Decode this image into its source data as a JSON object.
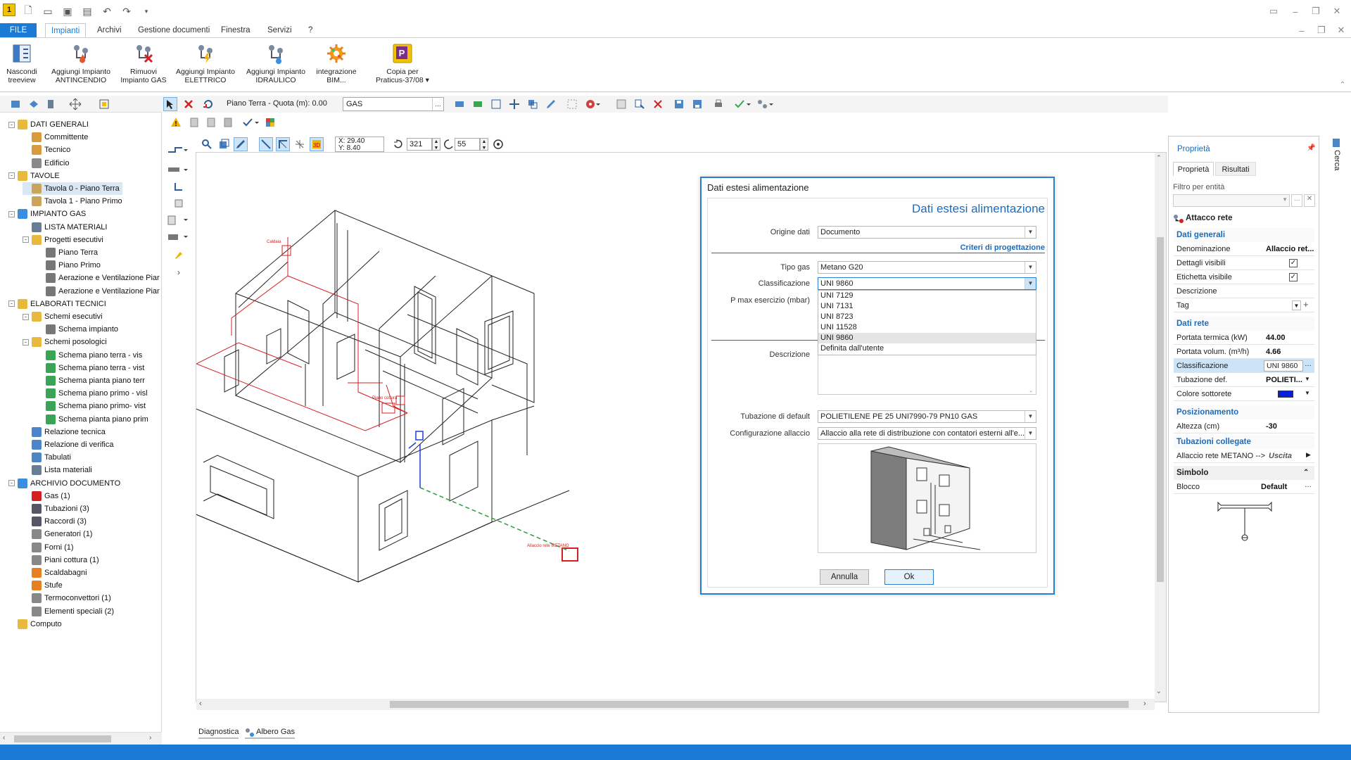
{
  "app": {
    "title_icon": "app-icon"
  },
  "menu": {
    "file": "FILE",
    "tabs": [
      "Impianti",
      "Archivi",
      "Gestione documenti",
      "Finestra",
      "Servizi",
      "?"
    ]
  },
  "ribbon": [
    {
      "label": "Nascondi\ntreeview",
      "icon": "treeview-icon"
    },
    {
      "label": "Aggiungi Impianto\nANTINCENDIO",
      "icon": "fire-system-icon"
    },
    {
      "label": "Rimuovi\nImpianto GAS",
      "icon": "remove-gas-icon"
    },
    {
      "label": "Aggiungi Impianto\nELETTRICO",
      "icon": "electric-system-icon"
    },
    {
      "label": "Aggiungi Impianto\nIDRAULICO",
      "icon": "hydraulic-system-icon"
    },
    {
      "label": "integrazione\nBIM...",
      "icon": "bim-icon"
    },
    {
      "label": "Copia per\nPraticus-37/08 ▾",
      "icon": "praticus-icon"
    }
  ],
  "toolbar": {
    "floor_label": "Piano Terra - Quota (m): 0.00",
    "system_select": "GAS",
    "coord_x": "X: 29.40",
    "coord_y": "Y: 8.40",
    "angle1": "321",
    "angle2": "55"
  },
  "tree": [
    {
      "label": "DATI GENERALI",
      "lvl": 0,
      "exp": "-",
      "icon": "folder"
    },
    {
      "label": "Committente",
      "lvl": 1,
      "icon": "person"
    },
    {
      "label": "Tecnico",
      "lvl": 1,
      "icon": "person"
    },
    {
      "label": "Edificio",
      "lvl": 1,
      "icon": "building"
    },
    {
      "label": "TAVOLE",
      "lvl": 0,
      "exp": "-",
      "icon": "folder"
    },
    {
      "label": "Tavola 0 - Piano Terra",
      "lvl": 1,
      "icon": "sheet",
      "sel": true
    },
    {
      "label": "Tavola 1 - Piano Primo",
      "lvl": 1,
      "icon": "sheet"
    },
    {
      "label": "IMPIANTO GAS",
      "lvl": 0,
      "exp": "-",
      "icon": "gas"
    },
    {
      "label": "LISTA MATERIALI",
      "lvl": 1,
      "icon": "list"
    },
    {
      "label": "Progetti esecutivi",
      "lvl": 1,
      "exp": "-",
      "icon": "folder"
    },
    {
      "label": "Piano Terra",
      "lvl": 2,
      "icon": "plan"
    },
    {
      "label": "Piano Primo",
      "lvl": 2,
      "icon": "plan"
    },
    {
      "label": "Aerazione e Ventilazione  Piar",
      "lvl": 2,
      "icon": "plan"
    },
    {
      "label": "Aerazione e Ventilazione  Piar",
      "lvl": 2,
      "icon": "plan"
    },
    {
      "label": "ELABORATI TECNICI",
      "lvl": 0,
      "exp": "-",
      "icon": "folder"
    },
    {
      "label": "Schemi esecutivi",
      "lvl": 1,
      "exp": "-",
      "icon": "folder"
    },
    {
      "label": "Schema impianto",
      "lvl": 2,
      "icon": "plan"
    },
    {
      "label": "Schemi posologici",
      "lvl": 1,
      "exp": "-",
      "icon": "folder"
    },
    {
      "label": "Schema piano terra - vis",
      "lvl": 2,
      "icon": "scheme"
    },
    {
      "label": "Schema piano terra - vist",
      "lvl": 2,
      "icon": "scheme"
    },
    {
      "label": "Schema pianta piano terr",
      "lvl": 2,
      "icon": "scheme"
    },
    {
      "label": "Schema piano primo - visl",
      "lvl": 2,
      "icon": "scheme"
    },
    {
      "label": "Schema piano primo- vist",
      "lvl": 2,
      "icon": "scheme"
    },
    {
      "label": "Schema pianta piano prim",
      "lvl": 2,
      "icon": "scheme"
    },
    {
      "label": "Relazione tecnica",
      "lvl": 1,
      "icon": "doc"
    },
    {
      "label": "Relazione di verifica",
      "lvl": 1,
      "icon": "doc"
    },
    {
      "label": "Tabulati",
      "lvl": 1,
      "icon": "table"
    },
    {
      "label": "Lista materiali",
      "lvl": 1,
      "icon": "list"
    },
    {
      "label": "ARCHIVIO DOCUMENTO",
      "lvl": 0,
      "exp": "-",
      "icon": "archive"
    },
    {
      "label": "Gas (1)",
      "lvl": 1,
      "icon": "gas2"
    },
    {
      "label": "Tubazioni (3)",
      "lvl": 1,
      "icon": "pipe"
    },
    {
      "label": "Raccordi (3)",
      "lvl": 1,
      "icon": "pipe"
    },
    {
      "label": "Generatori (1)",
      "lvl": 1,
      "icon": "gen"
    },
    {
      "label": "Forni (1)",
      "lvl": 1,
      "icon": "gen"
    },
    {
      "label": "Piani cottura (1)",
      "lvl": 1,
      "icon": "gen"
    },
    {
      "label": "Scaldabagni",
      "lvl": 1,
      "icon": "heat"
    },
    {
      "label": "Stufe",
      "lvl": 1,
      "icon": "heat"
    },
    {
      "label": "Termoconvettori (1)",
      "lvl": 1,
      "icon": "gen"
    },
    {
      "label": "Elementi speciali (2)",
      "lvl": 1,
      "icon": "gen"
    },
    {
      "label": "Computo",
      "lvl": 0,
      "icon": "calc"
    }
  ],
  "bottom_tabs": [
    "Diagnostica",
    "Albero Gas"
  ],
  "canvas_labels": {
    "caldaia": "Caldaia",
    "piano_cottura": "Piano cottura",
    "allaccio": "Allaccio rete METANO"
  },
  "dialog": {
    "title": "Dati estesi alimentazione",
    "header": "Dati estesi alimentazione",
    "origine_label": "Origine dati",
    "origine_value": "Documento",
    "criteri_link": "Criteri di progettazione",
    "tipo_gas_label": "Tipo gas",
    "tipo_gas_value": "Metano G20",
    "classificazione_label": "Classificazione",
    "classificazione_value": "UNI 9860",
    "pmax_label": "P max esercizio (mbar)",
    "options": [
      "UNI 7129",
      "UNI 7131",
      "UNI 8723",
      "UNI 11528",
      "UNI 9860",
      "Definita dall'utente"
    ],
    "selected_option": 4,
    "descrizione_label": "Descrizione",
    "tubazione_label": "Tubazione di default",
    "tubazione_value": "POLIETILENE PE 25 UNI7990-79 PN10 GAS",
    "config_label": "Configurazione allaccio",
    "config_value": "Allaccio alla rete di distribuzione con contatori esterni all'e...",
    "cancel": "Annulla",
    "ok": "Ok"
  },
  "props": {
    "title": "Proprietà",
    "tab1": "Proprietà",
    "tab2": "Risultati",
    "filter_label": "Filtro per entità",
    "entity": "Attacco rete",
    "sec_general": "Dati generali",
    "denominazione": "Denominazione",
    "denominazione_v": "Allaccio ret...",
    "dettagli": "Dettagli visibili",
    "etichetta": "Etichetta visibile",
    "descrizione": "Descrizione",
    "tag": "Tag",
    "sec_rete": "Dati rete",
    "portata_t": "Portata termica (kW)",
    "portata_t_v": "44.00",
    "portata_v": "Portata volum. (m³/h)",
    "portata_v_v": "4.66",
    "classificazione": "Classificazione",
    "classificazione_v": "UNI 9860",
    "tubazione": "Tubazione def.",
    "tubazione_v": "POLIETI...",
    "colore": "Colore sottorete",
    "colore_v": "#0a1fd8",
    "sec_pos": "Posizionamento",
    "altezza": "Altezza (cm)",
    "altezza_v": "-30",
    "sec_tub": "Tubazioni collegate",
    "allaccio": "Allaccio rete METANO -->",
    "allaccio_v": "Uscita",
    "sec_simbolo": "Simbolo",
    "blocco": "Blocco",
    "blocco_v": "Default",
    "cerca": "Cerca"
  },
  "colors": {
    "accent": "#1a7ad4",
    "link": "#1a6cbf",
    "status": "#1a7ad4"
  }
}
